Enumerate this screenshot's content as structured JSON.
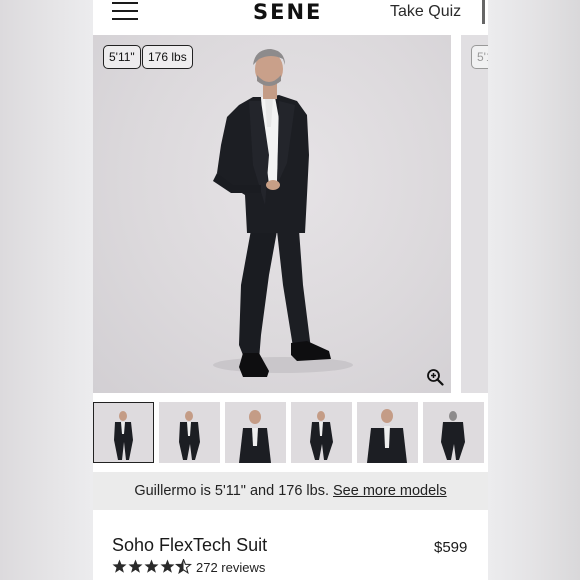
{
  "header": {
    "brand": "SENE",
    "quiz_label": "Take Quiz",
    "menu_icon": "hamburger-menu-icon"
  },
  "gallery": {
    "model_height": "5'11\"",
    "model_weight": "176 lbs",
    "next_chip_partial": "5'1",
    "zoom_icon": "zoom-in-icon",
    "thumbnail_count": 6,
    "selected_thumbnail": 1
  },
  "model_info": {
    "text": "Guillermo is 5'11\" and 176 lbs.",
    "link": "See more models"
  },
  "product": {
    "name": "Soho FlexTech Suit",
    "price": "$599",
    "rating": 4.5,
    "reviews": "272 reviews"
  },
  "colors": {
    "suit": "#1c1e23",
    "background": "#dedbde",
    "banner": "#ebebeb"
  }
}
